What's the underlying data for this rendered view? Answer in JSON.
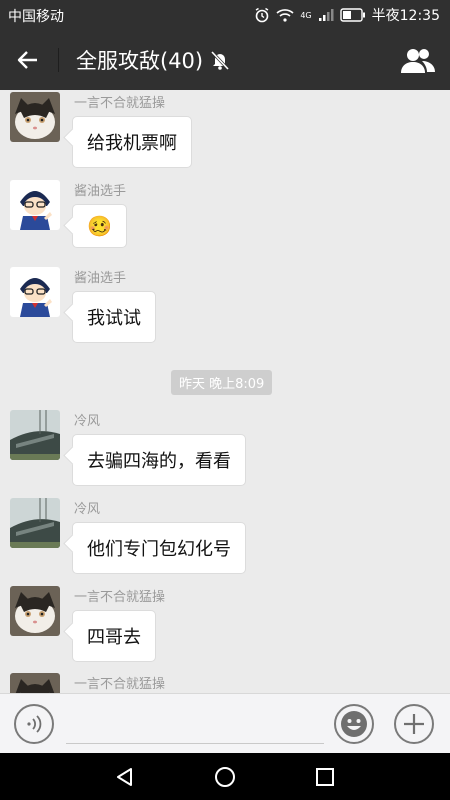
{
  "status": {
    "carrier": "中国移动",
    "network": "4G",
    "time": "半夜12:35"
  },
  "header": {
    "title": "全服攻敌(40)",
    "back_icon": "back-arrow-icon",
    "mute_icon": "bell-muted-icon",
    "members_icon": "group-members-icon"
  },
  "messages": [
    {
      "sender": "一言不合就猛操",
      "text": "给我机票啊",
      "avatar": "cat"
    },
    {
      "sender": "酱油选手",
      "text": "🥴",
      "avatar": "conan"
    },
    {
      "sender": "酱油选手",
      "text": "我试试",
      "avatar": "conan"
    },
    {
      "sender": "冷风",
      "text": "去骗四海的，看看",
      "avatar": "building"
    },
    {
      "sender": "冷风",
      "text": "他们专门包幻化号",
      "avatar": "building"
    },
    {
      "sender": "一言不合就猛操",
      "text": "四哥去",
      "avatar": "cat"
    },
    {
      "sender": "一言不合就猛操",
      "text": "",
      "avatar": "cat"
    }
  ],
  "timestamp": "昨天 晚上8:09",
  "input": {
    "value": "",
    "voice_icon": "voice-icon",
    "emoji_icon": "emoji-icon",
    "plus_icon": "plus-icon"
  },
  "nav": {
    "back": "nav-back-icon",
    "home": "nav-home-icon",
    "recent": "nav-recent-icon"
  },
  "colors": {
    "header_bg": "#303030",
    "chat_bg": "#ebebeb",
    "bubble_bg": "#ffffff",
    "timestamp_bg": "#cecece"
  }
}
